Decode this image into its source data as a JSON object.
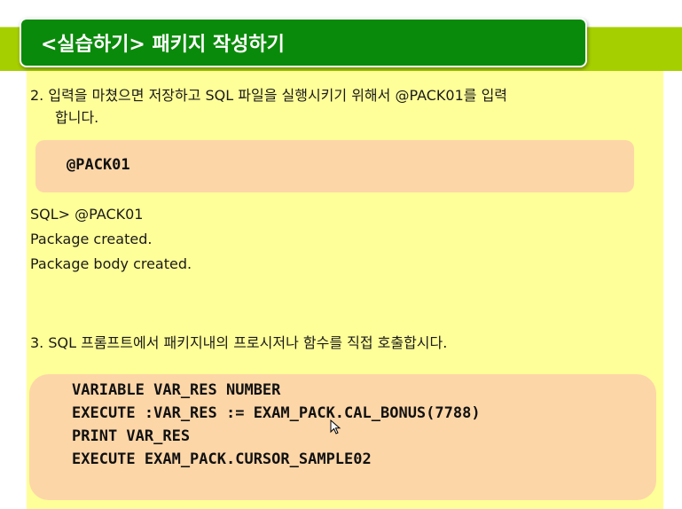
{
  "slide": {
    "title": "<실습하기> 패키지 작성하기"
  },
  "step2": {
    "line1": "2. 입력을 마쳤으면 저장하고 SQL 파일을 실행시키기 위해서 @PACK01를 입력",
    "line2": "합니다."
  },
  "command_box": {
    "code": "@PACK01"
  },
  "output": {
    "lines": [
      "SQL> @PACK01",
      "Package created.",
      "Package body created."
    ]
  },
  "step3": {
    "text": "3. SQL 프롬프트에서 패키지내의 프로시저나 함수를 직접 호출합시다."
  },
  "code_box": {
    "lines": [
      "VARIABLE VAR_RES NUMBER",
      "EXECUTE :VAR_RES := EXAM_PACK.CAL_BONUS(7788)",
      "PRINT VAR_RES",
      "EXECUTE EXAM_PACK.CURSOR_SAMPLE02"
    ]
  },
  "colors": {
    "title_bg": "#0a8a0a",
    "band": "#a6cf00",
    "panel": "#ffff99",
    "code_box": "#fdd6a8"
  }
}
